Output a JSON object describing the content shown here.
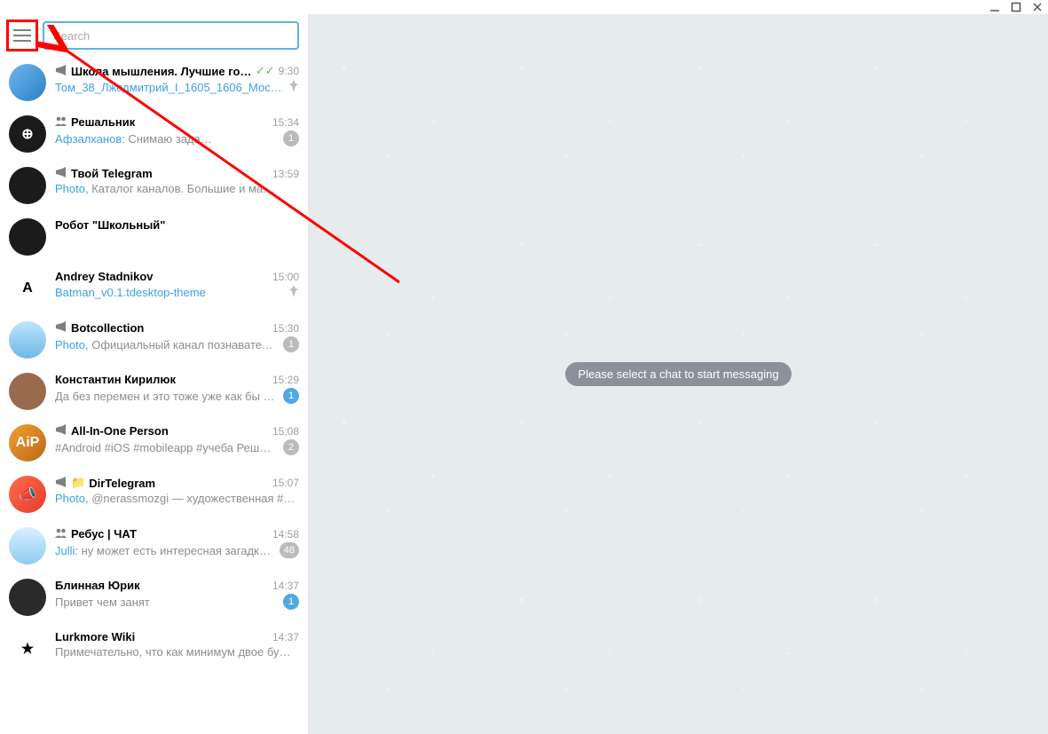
{
  "search": {
    "placeholder": "Search"
  },
  "main": {
    "placeholder": "Please select a chat to start messaging"
  },
  "chats": [
    {
      "type_icon": "megaphone",
      "name": "Школа мышления. Лучшие го…",
      "checks": true,
      "time": "9:30",
      "link": "Том_38_Лжедмитрий_I_1605_1606_Мос…",
      "pinned": true,
      "avatar_bg": "linear-gradient(135deg,#6db7f2,#2c7fc1)",
      "avatar_text": ""
    },
    {
      "type_icon": "group",
      "name": "Решальник",
      "time": "15:34",
      "sender": "Афзалханов:",
      "preview": " Снимаю зада…",
      "badge": "1",
      "avatar_bg": "#1b1b1b",
      "avatar_text": "⊕"
    },
    {
      "type_icon": "megaphone",
      "name": "Твой Telegram",
      "time": "13:59",
      "media": "Photo,",
      "preview": " Каталог каналов. Большие и ма…",
      "avatar_bg": "#1b1b1b",
      "avatar_text": ""
    },
    {
      "name": "Робот \"Школьный\"",
      "avatar_bg": "#1b1b1b",
      "avatar_text": ""
    },
    {
      "name": "Andrey Stadnikov",
      "time": "15:00",
      "link": "Batman_v0.1.tdesktop-theme",
      "pinned": true,
      "avatar_bg": "#fff",
      "avatar_text": "A",
      "avatar_color": "#000"
    },
    {
      "type_icon": "megaphone",
      "name": "Botcollection",
      "time": "15:30",
      "media": "Photo,",
      "preview": " Официальный канал познавател…",
      "badge": "1",
      "avatar_bg": "linear-gradient(180deg,#bde5fb,#6fb8e8)",
      "avatar_text": ""
    },
    {
      "name": "Константин Кирилюк",
      "time": "15:29",
      "preview": "Да без перемен и это тоже уже как бы …",
      "badge": "1",
      "badge_blue": true,
      "avatar_bg": "#9a6a4e",
      "avatar_text": ""
    },
    {
      "type_icon": "megaphone",
      "name": "All-In-One Person",
      "time": "15:08",
      "preview": "#Android #iOS #mobileapp #учеба  Реш…",
      "badge": "2",
      "avatar_bg": "linear-gradient(135deg,#f0a030,#c0661a)",
      "avatar_text": "AiP"
    },
    {
      "type_icon": "megaphone",
      "folder": true,
      "name": "DirTelegram",
      "time": "15:07",
      "media": "Photo,",
      "preview": " @nerassmozgi — художественная #л…",
      "avatar_bg": "linear-gradient(135deg,#ff6b4a,#e63c2c)",
      "avatar_text": "📣"
    },
    {
      "type_icon": "group",
      "name": "Ребус | ЧАТ",
      "time": "14:58",
      "sender": "Julli:",
      "preview": " ну может есть интересная загадка…",
      "badge": "48",
      "avatar_bg": "linear-gradient(180deg,#d9f0ff,#8fccf2)",
      "avatar_text": ""
    },
    {
      "name": "Блинная Юрик",
      "time": "14:37",
      "preview": "Привет чем занят",
      "badge": "1",
      "badge_blue": true,
      "avatar_bg": "#2a2a2a",
      "avatar_text": ""
    },
    {
      "name": "Lurkmore Wiki",
      "time": "14:37",
      "preview": "Примечательно, что как минимум двое бу…",
      "avatar_bg": "#fff",
      "avatar_text": "★",
      "avatar_color": "#000"
    }
  ]
}
